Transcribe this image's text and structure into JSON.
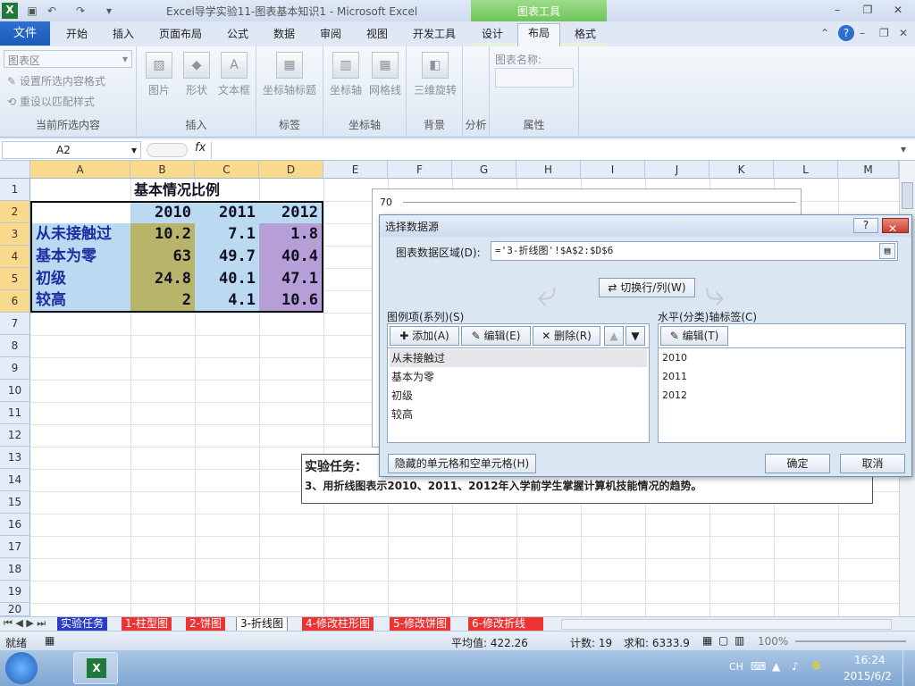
{
  "window": {
    "title": "Excel导学实验11-图表基本知识1  -  Microsoft Excel",
    "context_tools": "图表工具"
  },
  "ribbon": {
    "file_tab": "文件",
    "tabs": [
      "开始",
      "插入",
      "页面布局",
      "公式",
      "数据",
      "审阅",
      "视图",
      "开发工具",
      "设计",
      "布局",
      "格式"
    ],
    "active_tab": "布局",
    "chart_area_select": "图表区",
    "current_selection": {
      "format_selection": "设置所选内容格式",
      "reset_style": "重设以匹配样式",
      "label": "当前所选内容"
    },
    "insert": {
      "picture": "图片",
      "shapes": "形状",
      "textbox": "文本框",
      "label": "插入"
    },
    "labels": {
      "axis_titles": "坐标轴标题",
      "label": "标签"
    },
    "axes": {
      "axes": "坐标轴",
      "gridlines": "网格线",
      "label": "坐标轴"
    },
    "background": {
      "rotation": "三维旋转",
      "label": "背景"
    },
    "analysis": {
      "label": "分析"
    },
    "properties": {
      "chart_name": "图表名称:",
      "label": "属性"
    }
  },
  "formula_bar": {
    "name_box": "A2",
    "fx": "fx"
  },
  "columns": [
    "A",
    "B",
    "C",
    "D",
    "E",
    "F",
    "G",
    "H",
    "I",
    "J",
    "K",
    "L",
    "M"
  ],
  "rows": [
    "1",
    "2",
    "3",
    "4",
    "5",
    "6",
    "7",
    "8",
    "9",
    "10",
    "11",
    "12",
    "13",
    "14",
    "15",
    "16",
    "17",
    "18",
    "19",
    "20"
  ],
  "table": {
    "title": "基本情况比例",
    "years": [
      "2010",
      "2011",
      "2012"
    ],
    "rows": [
      {
        "label": "从未接触过",
        "values": [
          "10.2",
          "7.1",
          "1.8"
        ]
      },
      {
        "label": "基本为零",
        "values": [
          "63",
          "49.7",
          "40.4"
        ]
      },
      {
        "label": "初级",
        "values": [
          "24.8",
          "40.1",
          "47.1"
        ]
      },
      {
        "label": "较高",
        "values": [
          "2",
          "4.1",
          "10.6"
        ]
      }
    ],
    "colors": {
      "header": "#bcd9f2",
      "col_b": "#b8b56a",
      "col_c": "#bcd9f2",
      "col_d": "#b59fd6",
      "labels": "#bcd9f2"
    }
  },
  "chart_stub": {
    "axis_value": "70"
  },
  "task_box": {
    "heading": "实验任务：",
    "text": "3、用折线图表示2010、2011、2012年入学前学生掌握计算机技能情况的趋势。"
  },
  "dialog": {
    "title": "选择数据源",
    "help": "?",
    "range_label": "图表数据区域(D):",
    "range_value": "='3-折线图'!$A$2:$D$6",
    "switch_button": "切换行/列(W)",
    "series_label": "图例项(系列)(S)",
    "add_button": "添加(A)",
    "edit_button": "编辑(E)",
    "delete_button": "删除(R)",
    "series": [
      "从未接触过",
      "基本为零",
      "初级",
      "较高"
    ],
    "category_label": "水平(分类)轴标签(C)",
    "category_edit_button": "编辑(T)",
    "categories": [
      "2010",
      "2011",
      "2012"
    ],
    "hidden_cells_button": "隐藏的单元格和空单元格(H)",
    "ok_button": "确定",
    "cancel_button": "取消"
  },
  "sheet_tabs": [
    "实验任务",
    "1-柱型图",
    "2-饼图",
    "3-折线图",
    "4-修改柱形图",
    "5-修改饼图",
    "6-修改折线"
  ],
  "active_sheet": "3-折线图",
  "status_bar": {
    "mode": "就绪",
    "average": "平均值: 422.26",
    "count": "计数: 19",
    "sum": "求和: 6333.9",
    "zoom": "100%"
  },
  "taskbar": {
    "lang": "CH",
    "time": "16:24",
    "date": "2015/6/2"
  }
}
